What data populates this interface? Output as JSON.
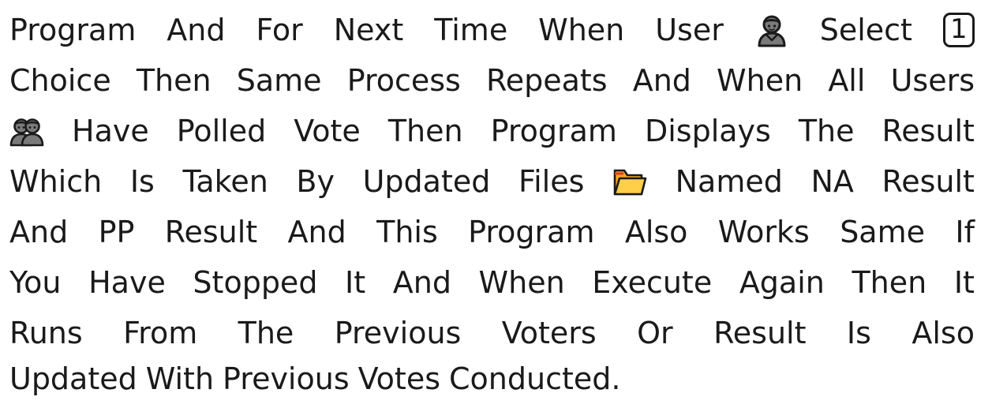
{
  "paragraph": {
    "lines": [
      {
        "words": [
          "Program",
          "And",
          "For",
          "Next",
          "Time",
          "When",
          "User"
        ],
        "icon": "person-icon",
        "after_icon": [
          "Select"
        ],
        "keycap": "1"
      },
      {
        "words": [
          "Choice",
          "Then",
          "Same",
          "Process",
          "Repeats",
          "And",
          "When",
          "All",
          "Users"
        ]
      },
      {
        "icon": "people-icon",
        "words": [
          "Have",
          "Polled",
          "Vote",
          "Then",
          "Program",
          "Displays",
          "The",
          "Result"
        ]
      },
      {
        "words": [
          "Which",
          "Is",
          "Taken",
          "By",
          "Updated",
          "Files"
        ],
        "icon": "folder-icon",
        "after_icon": [
          "Named",
          "NA",
          "Result"
        ]
      },
      {
        "words": [
          "And",
          "PP",
          "Result",
          "And",
          "This",
          "Program",
          "Also",
          "Works",
          "Same",
          "If"
        ]
      },
      {
        "words": [
          "You",
          "Have",
          "Stopped",
          "It",
          "And",
          "When",
          "Execute",
          "Again",
          "Then",
          "It"
        ]
      },
      {
        "words": [
          "Runs",
          "From",
          "The",
          "Previous",
          "Voters",
          "Or",
          "Result",
          "Is",
          "Also"
        ]
      },
      {
        "words": [
          "Updated",
          "With",
          "Previous",
          "Votes",
          "Conducted."
        ]
      }
    ]
  },
  "colors": {
    "text": "#1a1a1a",
    "person_fill": "#7a7a7a",
    "folder_back": "#f5a623",
    "folder_front": "#ffcf4a",
    "folder_tab": "#e03a2e"
  }
}
